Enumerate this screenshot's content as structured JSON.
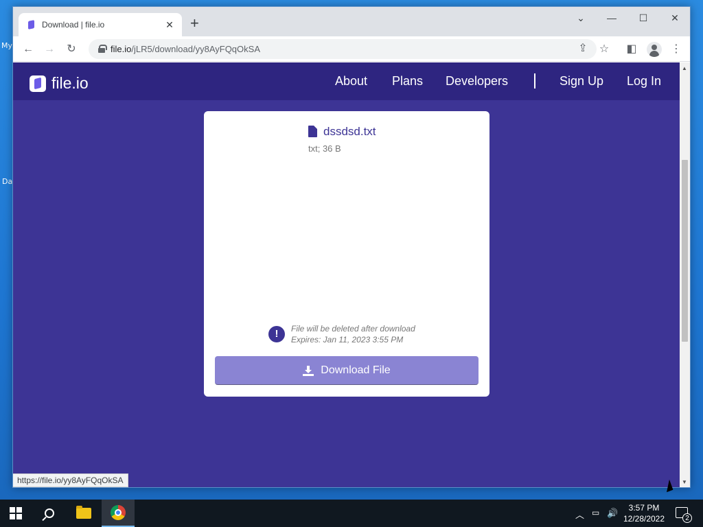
{
  "desktop": {
    "labels": [
      "My",
      "Da"
    ]
  },
  "browser": {
    "tab": {
      "title": "Download | file.io",
      "close": "✕"
    },
    "new_tab": "+",
    "window_controls": {
      "chevron": "⌄",
      "minimize": "—",
      "maximize": "☐",
      "close": "✕"
    },
    "toolbar": {
      "back": "←",
      "forward": "→",
      "reload": "↻",
      "url_host": "file.io",
      "url_path": "/jLR5/download/yy8AyFQqOkSA",
      "share": "⇪",
      "bookmark": "☆",
      "side_panel": "◧",
      "menu": "⋮"
    },
    "status_url": "https://file.io/yy8AyFQqOkSA"
  },
  "site": {
    "logo_text": "file.io",
    "nav": {
      "about": "About",
      "plans": "Plans",
      "developers": "Developers",
      "sign_up": "Sign Up",
      "log_in": "Log In"
    },
    "file": {
      "name": "dssdsd.txt",
      "meta": "txt; 36 B"
    },
    "warning": {
      "icon": "!",
      "line1": "File will be deleted after download",
      "line2": "Expires: Jan 11, 2023 3:55 PM"
    },
    "download_button": "Download File"
  },
  "taskbar": {
    "time": "3:57 PM",
    "date": "12/28/2022",
    "notifications": "2",
    "tray_chevron": "︿",
    "volume": "🔊"
  },
  "colors": {
    "page_bg": "#3d3495",
    "nav_bg": "#2e2580",
    "button_bg": "#8a84d3"
  }
}
